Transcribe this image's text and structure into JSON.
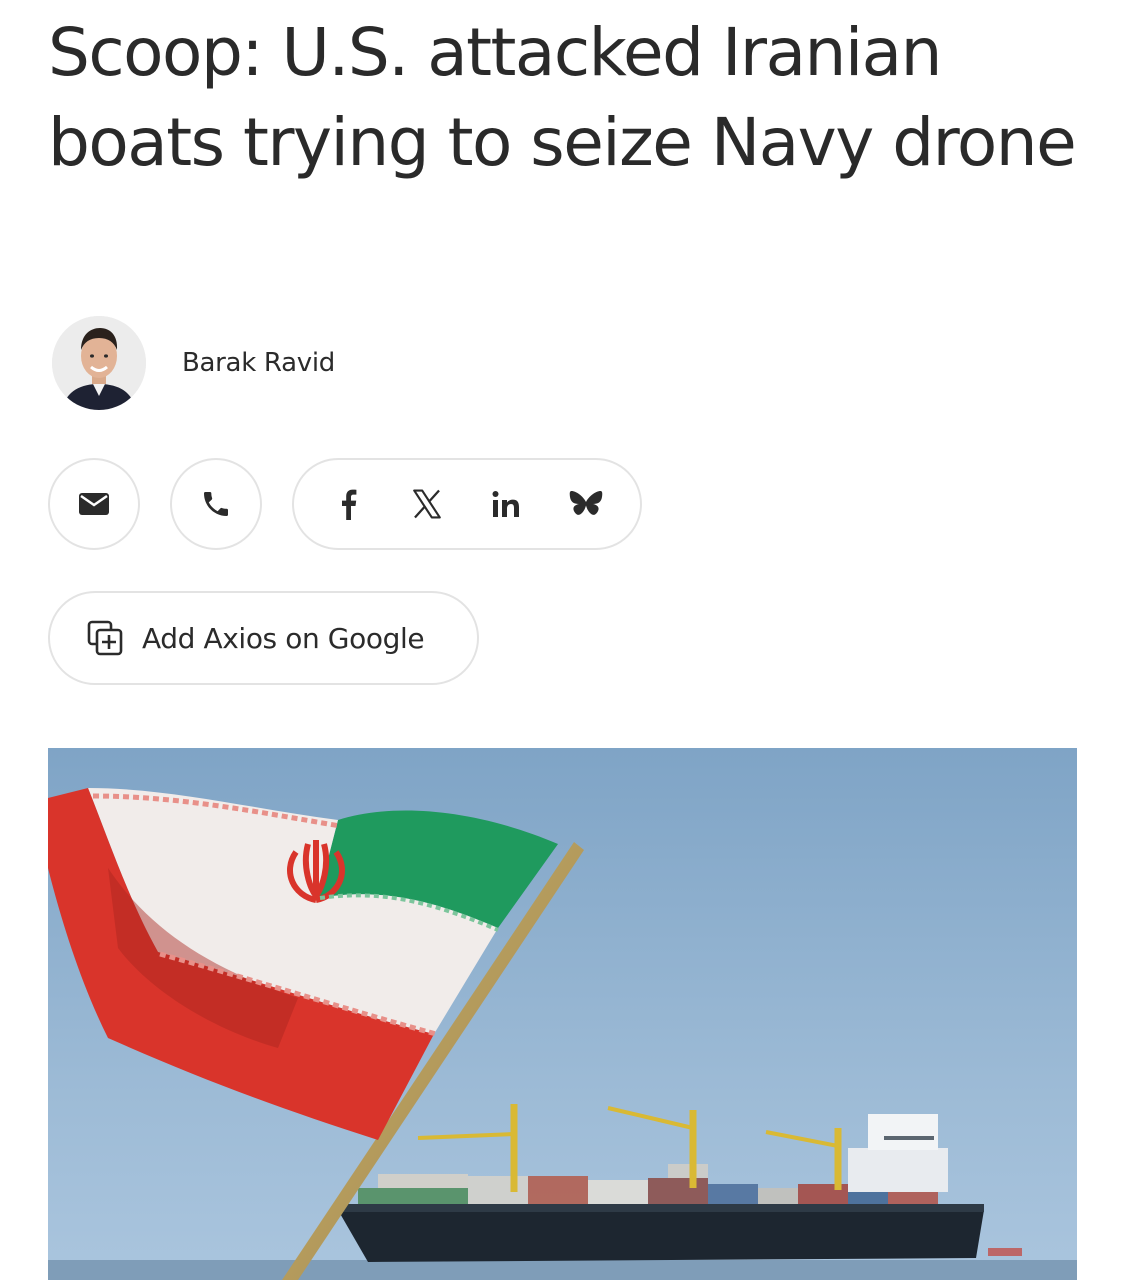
{
  "article": {
    "headline": "Scoop: U.S. attacked Iranian boats trying to seize Navy drone",
    "author": {
      "name": "Barak Ravid"
    }
  },
  "share": {
    "email_icon": "envelope-icon",
    "phone_icon": "phone-icon",
    "social_icons": [
      "facebook-icon",
      "x-icon",
      "linkedin-icon",
      "bluesky-icon"
    ]
  },
  "add_source_button": {
    "label": "Add Axios on Google",
    "icon": "add-to-collection-icon"
  },
  "colors": {
    "text": "#2b2b2b",
    "border": "#e3e3e3",
    "sky": "#8fb1cf",
    "flag_green": "#1f9a5e",
    "flag_red": "#d9342b"
  }
}
